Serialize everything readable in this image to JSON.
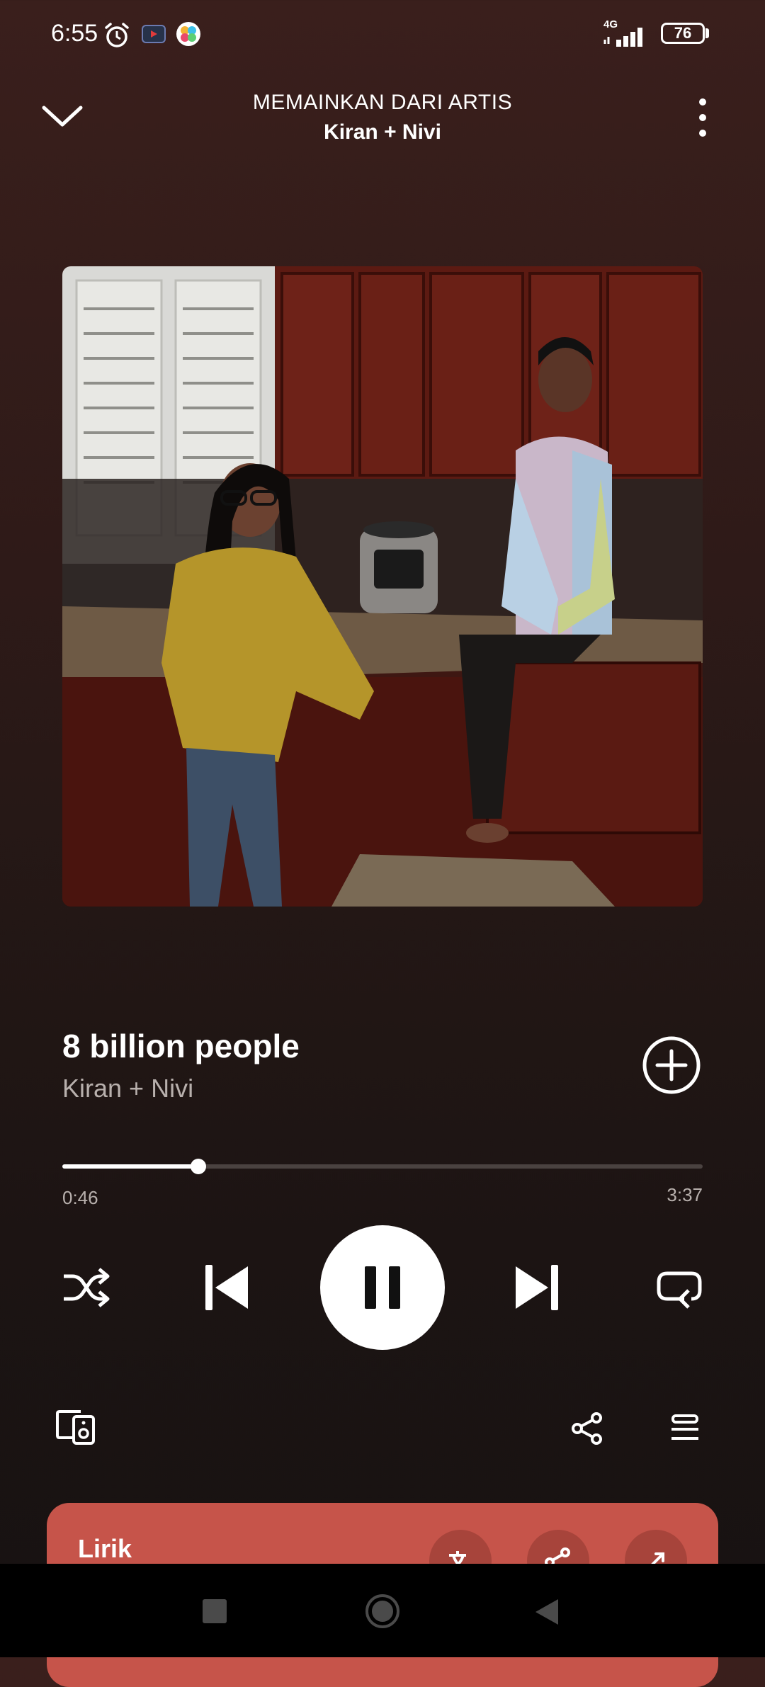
{
  "status_bar": {
    "time": "6:55",
    "network": "4G",
    "battery": "76"
  },
  "header": {
    "context": "MEMAINKAN DARI ARTIS",
    "artist": "Kiran + Nivi"
  },
  "track": {
    "title": "8 billion people",
    "artist": "Kiran + Nivi"
  },
  "progress": {
    "elapsed": "0:46",
    "total": "3:37",
    "fraction": 0.212
  },
  "lyrics": {
    "label": "Lirik"
  },
  "icons": {
    "collapse": "chevron-down-icon",
    "more": "more-vertical-icon",
    "add": "add-circle-icon",
    "shuffle": "shuffle-icon",
    "previous": "skip-previous-icon",
    "pause": "pause-icon",
    "next": "skip-next-icon",
    "repeat": "repeat-icon",
    "devices": "connect-devices-icon",
    "share": "share-icon",
    "queue": "queue-icon"
  },
  "colors": {
    "background_top": "#3a1f1c",
    "background_bottom": "#171212",
    "lyrics_card": "#c6544a",
    "secondary_text": "#b8b0ad"
  }
}
